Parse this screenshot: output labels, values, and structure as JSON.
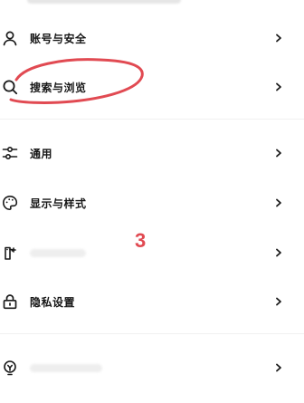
{
  "settings": {
    "items": [
      {
        "icon": "user-icon",
        "label": "账号与安全"
      },
      {
        "icon": "search-icon",
        "label": "搜索与浏览"
      },
      {
        "icon": "sliders-icon",
        "label": "通用"
      },
      {
        "icon": "palette-icon",
        "label": "显示与样式"
      },
      {
        "icon": "share-device-icon",
        "label": ""
      },
      {
        "icon": "lock-icon",
        "label": "隐私设置"
      },
      {
        "icon": "bulb-icon",
        "label": ""
      }
    ]
  },
  "annotation": {
    "number": "3",
    "color": "#e14a52"
  },
  "colors": {
    "text": "#161616",
    "divider": "#f0f0f0",
    "background": "#ffffff"
  }
}
